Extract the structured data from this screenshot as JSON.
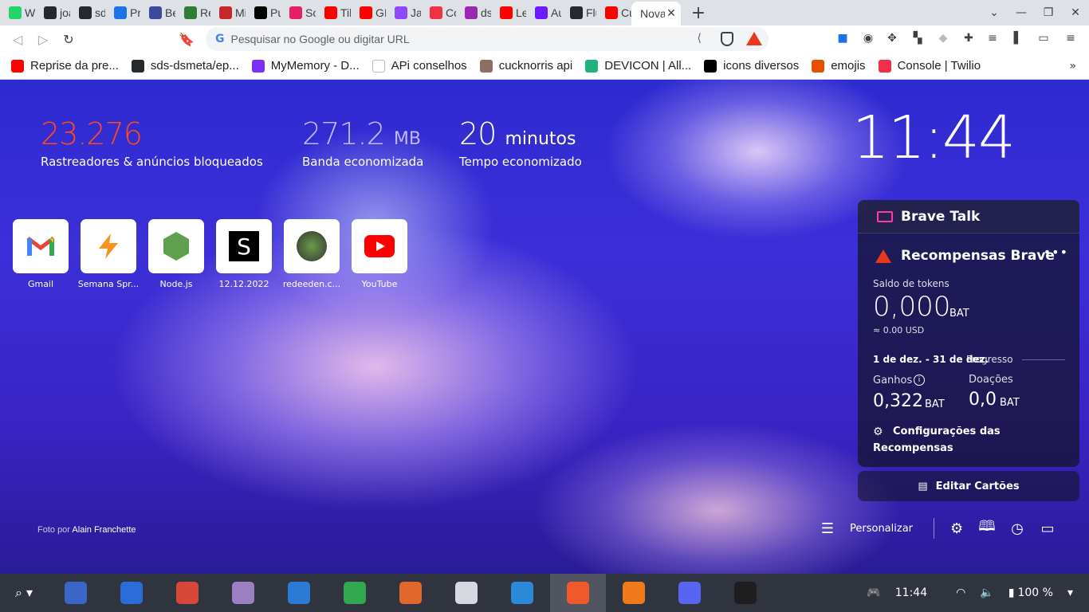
{
  "tabs": [
    {
      "title": "Wh",
      "icon": "whatsapp-icon",
      "color": "#25d366"
    },
    {
      "title": "joac",
      "icon": "github-icon",
      "color": "#24292e"
    },
    {
      "title": "sds",
      "icon": "github-icon",
      "color": "#24292e"
    },
    {
      "title": "Prin",
      "icon": "play-circle-icon",
      "color": "#1a73e8"
    },
    {
      "title": "Bed",
      "icon": "bird-icon",
      "color": "#3b4a9e"
    },
    {
      "title": "Red",
      "icon": "globe-icon",
      "color": "#2e7d32"
    },
    {
      "title": "Min",
      "icon": "ruby-icon",
      "color": "#c62828"
    },
    {
      "title": "Pub",
      "icon": "pa-icon",
      "color": "#000000"
    },
    {
      "title": "Soft",
      "icon": "app-icon",
      "color": "#e91e63"
    },
    {
      "title": "Tikto",
      "icon": "youtube-icon",
      "color": "#ff0000"
    },
    {
      "title": "GIU",
      "icon": "youtube-icon",
      "color": "#ff0000"
    },
    {
      "title": "Java",
      "icon": "twitch-icon",
      "color": "#9146ff"
    },
    {
      "title": "Con",
      "icon": "twilio-icon",
      "color": "#f22f46"
    },
    {
      "title": "dsm",
      "icon": "h-icon",
      "color": "#9c27b0"
    },
    {
      "title": "Let M",
      "icon": "youtube-icon",
      "color": "#ff0000"
    },
    {
      "title": "Aula",
      "icon": "video-icon",
      "color": "#6a1bff"
    },
    {
      "title": "Flutt",
      "icon": "github-icon",
      "color": "#24292e"
    },
    {
      "title": "Curs",
      "icon": "youtube-icon",
      "color": "#ff0000"
    },
    {
      "title": "Nova",
      "icon": "brave-icon",
      "color": "#ffffff",
      "active": true
    }
  ],
  "omnibox": {
    "placeholder": "Pesquisar no Google ou digitar URL"
  },
  "bookmarks": [
    {
      "label": "Reprise da pre...",
      "icon": "youtube-icon",
      "color": "#ff0000"
    },
    {
      "label": "sds-dsmeta/ep...",
      "icon": "github-icon",
      "color": "#24292e"
    },
    {
      "label": "MyMemory - D...",
      "icon": "mymemory-icon",
      "color": "#7b2ff7"
    },
    {
      "label": "APi conselhos",
      "icon": "page-icon",
      "color": "#ffffff"
    },
    {
      "label": "cucknorris api",
      "icon": "chuck-icon",
      "color": "#8d6e63"
    },
    {
      "label": "DEVICON | All...",
      "icon": "devicon-icon",
      "color": "#20b27a"
    },
    {
      "label": "icons diversos",
      "icon": "dev-icon",
      "color": "#000000"
    },
    {
      "label": "emojis",
      "icon": "emoji-icon",
      "color": "#e65100"
    },
    {
      "label": "Console | Twilio",
      "icon": "twilio-icon",
      "color": "#f22f46"
    }
  ],
  "stats": {
    "trackers": {
      "value": "23.276",
      "label": "Rastreadores & anúncios bloqueados",
      "color": "#ff4a1c"
    },
    "bandwidth": {
      "value": "271.2",
      "unit": "MB",
      "label": "Banda economizada",
      "color": "#c1b6ff"
    },
    "time": {
      "value": "20",
      "unit": "minutos",
      "label": "Tempo economizado",
      "color": "#ffffff"
    }
  },
  "clock": "11:44",
  "top_sites": [
    {
      "name": "Gmail",
      "icon": "gmail-icon"
    },
    {
      "name": "Semana Spr...",
      "icon": "bolt-icon"
    },
    {
      "name": "Node.js",
      "icon": "nodejs-icon"
    },
    {
      "name": "12.12.2022",
      "icon": "s-icon"
    },
    {
      "name": "redeeden.c...",
      "icon": "rede-eden-icon"
    },
    {
      "name": "YouTube",
      "icon": "youtube-icon"
    }
  ],
  "photo_credit": {
    "prefix": "Foto por",
    "author": "Alain Franchette"
  },
  "rewards": {
    "talk_title": "Brave Talk",
    "title": "Recompensas Brave",
    "balance_label": "Saldo de tokens",
    "balance": "0,000",
    "balance_unit": "BAT",
    "usd": "≈ 0.00 USD",
    "period": "1 de dez. - 31 de dez.",
    "progress_label": "Progresso",
    "earnings_label": "Ganhos",
    "earnings": "0,322",
    "earnings_unit": "BAT",
    "donations_label": "Doações",
    "donations": "0,0",
    "donations_unit": "BAT",
    "settings_line1": "Configurações das",
    "settings_line2": "Recompensas"
  },
  "edit_cards": "Editar Cartões",
  "customize": "Personalizar",
  "taskbar": {
    "time": "11:44",
    "battery": "100 %",
    "apps": [
      {
        "name": "mail-app",
        "color": "#3a67c7"
      },
      {
        "name": "accessibility-app",
        "color": "#2a6dd8"
      },
      {
        "name": "book-app",
        "color": "#d9473b"
      },
      {
        "name": "files-app",
        "color": "#9b7fc1"
      },
      {
        "name": "writer-app",
        "color": "#2a7ad5"
      },
      {
        "name": "calc-app",
        "color": "#2fa84f"
      },
      {
        "name": "impress-app",
        "color": "#e0682c"
      },
      {
        "name": "settings-app",
        "color": "#d8d8e0"
      },
      {
        "name": "vscode-app",
        "color": "#2a8ad8"
      },
      {
        "name": "brave-app",
        "color": "#f05a2a",
        "active": true
      },
      {
        "name": "media-app",
        "color": "#f07a1a"
      },
      {
        "name": "discord-app",
        "color": "#5865f2"
      },
      {
        "name": "terminal-app",
        "color": "#1e1e1e"
      }
    ]
  }
}
